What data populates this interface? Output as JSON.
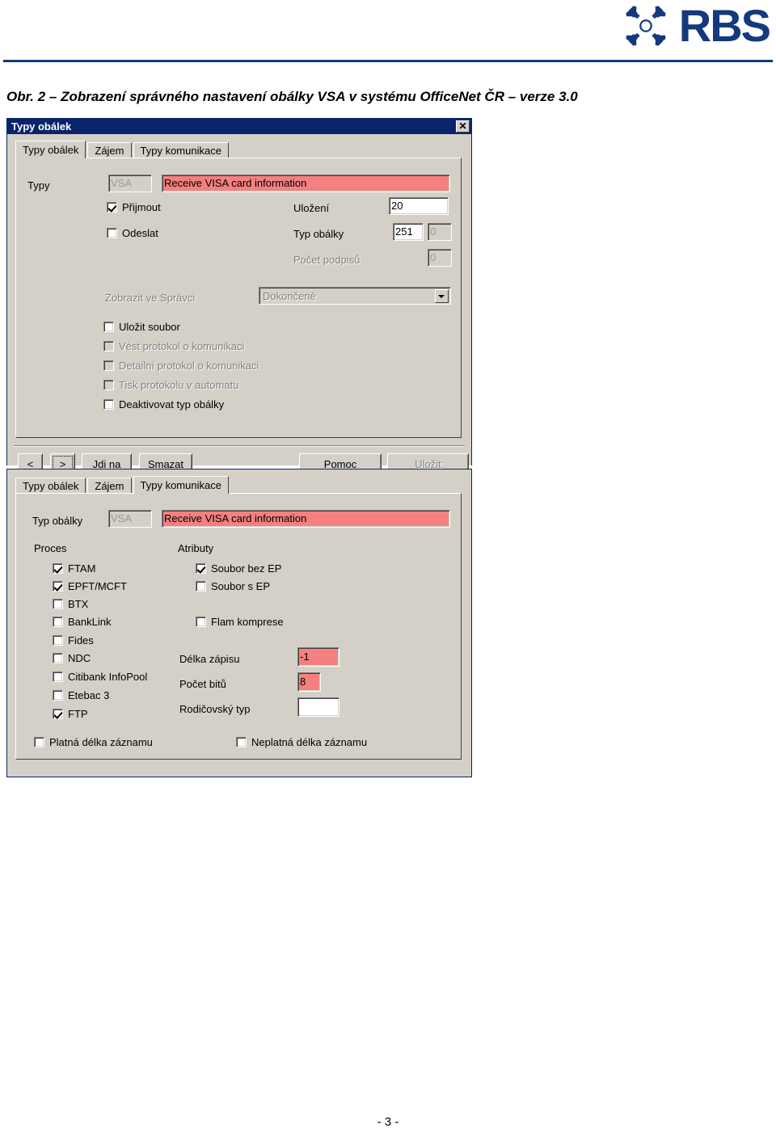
{
  "header": {
    "brand_wordmark": "RBS",
    "brand_mark_icon": "rbs-daisy-wheel-icon",
    "brand_color": "#14397d"
  },
  "caption": {
    "text": "Obr. 2 – Zobrazení správného nastavení obálky VSA v systému OfficeNet ČR – verze 3.0"
  },
  "footer": {
    "page_number": "- 3 -"
  },
  "colors": {
    "dialog_face": "#d4d0c8",
    "titlebar": "#0a246a",
    "highlight_field": "#f58080",
    "disabled_text": "#808080"
  },
  "dialog1": {
    "title": "Typy obálek",
    "close_label": "✕",
    "tabs": [
      {
        "label": "Typy obálek",
        "active": true
      },
      {
        "label": "Zájem",
        "active": false
      },
      {
        "label": "Typy komunikace",
        "active": false
      }
    ],
    "fields": {
      "typy_label": "Typy",
      "typy_code_value": "VSA",
      "typy_desc_value": "Receive VISA card information",
      "ulozeni_label": "Uložení",
      "ulozeni_value": "20",
      "typ_obalky_label": "Typ obálky",
      "typ_obalky_value": "251",
      "typ_obalky_value2": "0",
      "pocet_podpisu_label": "Počet podpisů",
      "pocet_podpisu_value": "0",
      "zobrazit_label": "Zobrazit ve Správci",
      "zobrazit_value": "Dokončené"
    },
    "checkboxes": [
      {
        "label": "Přijmout",
        "checked": true,
        "disabled": false
      },
      {
        "label": "Odeslat",
        "checked": false,
        "disabled": false
      },
      {
        "label": "Uložit soubor",
        "checked": false,
        "disabled": false
      },
      {
        "label": "Vést protokol o komunikaci",
        "checked": false,
        "disabled": true
      },
      {
        "label": "Detailní protokol o komunikaci",
        "checked": false,
        "disabled": true
      },
      {
        "label": "Tisk protokolu v automatu",
        "checked": false,
        "disabled": true
      },
      {
        "label": "Deaktivovat typ obálky",
        "checked": false,
        "disabled": false
      }
    ],
    "buttons": [
      {
        "name": "prev",
        "label": "<",
        "accel": "",
        "disabled": false,
        "focused": false
      },
      {
        "name": "next",
        "label": ">",
        "accel": "",
        "disabled": false,
        "focused": true
      },
      {
        "name": "goto",
        "label": "Jdi na",
        "accel": "J",
        "disabled": false,
        "focused": false
      },
      {
        "name": "delete",
        "label": "Smazat",
        "accel": "S",
        "disabled": false,
        "focused": false
      },
      {
        "name": "help",
        "label": "Pomoc",
        "accel": "P",
        "disabled": false,
        "focused": false
      },
      {
        "name": "save",
        "label": "Uložit",
        "accel": "U",
        "disabled": true,
        "focused": false
      }
    ]
  },
  "dialog2": {
    "tabs": [
      {
        "label": "Typy obálek",
        "active": false
      },
      {
        "label": "Zájem",
        "active": false
      },
      {
        "label": "Typy komunikace",
        "active": true
      }
    ],
    "fields": {
      "typ_obalky_label": "Typ obálky",
      "typ_obalky_code": "VSA",
      "typ_obalky_desc": "Receive VISA card information",
      "proces_group_label": "Proces",
      "atributy_group_label": "Atributy",
      "delka_zapisu_label": "Délka zápisu",
      "delka_zapisu_value": "-1",
      "pocet_bitu_label": "Počet bitů",
      "pocet_bitu_value": "8",
      "rodicovsky_typ_label": "Rodičovský typ",
      "rodicovsky_typ_value": ""
    },
    "proces_checkboxes": [
      {
        "label": "FTAM",
        "checked": true
      },
      {
        "label": "EPFT/MCFT",
        "checked": true
      },
      {
        "label": "BTX",
        "checked": false
      },
      {
        "label": "BankLink",
        "checked": false
      },
      {
        "label": "Fides",
        "checked": false
      },
      {
        "label": "NDC",
        "checked": false
      },
      {
        "label": "Citibank InfoPool",
        "checked": false
      },
      {
        "label": "Etebac 3",
        "checked": false
      },
      {
        "label": "FTP",
        "checked": true
      }
    ],
    "atributy_checkboxes": [
      {
        "label": "Soubor bez EP",
        "checked": true
      },
      {
        "label": "Soubor s EP",
        "checked": false
      },
      {
        "label": "Flam komprese",
        "checked": false
      }
    ],
    "bottom_checkboxes": [
      {
        "label": "Platná délka záznamu",
        "checked": false
      },
      {
        "label": "Neplatná délka záznamu",
        "checked": false
      }
    ]
  }
}
